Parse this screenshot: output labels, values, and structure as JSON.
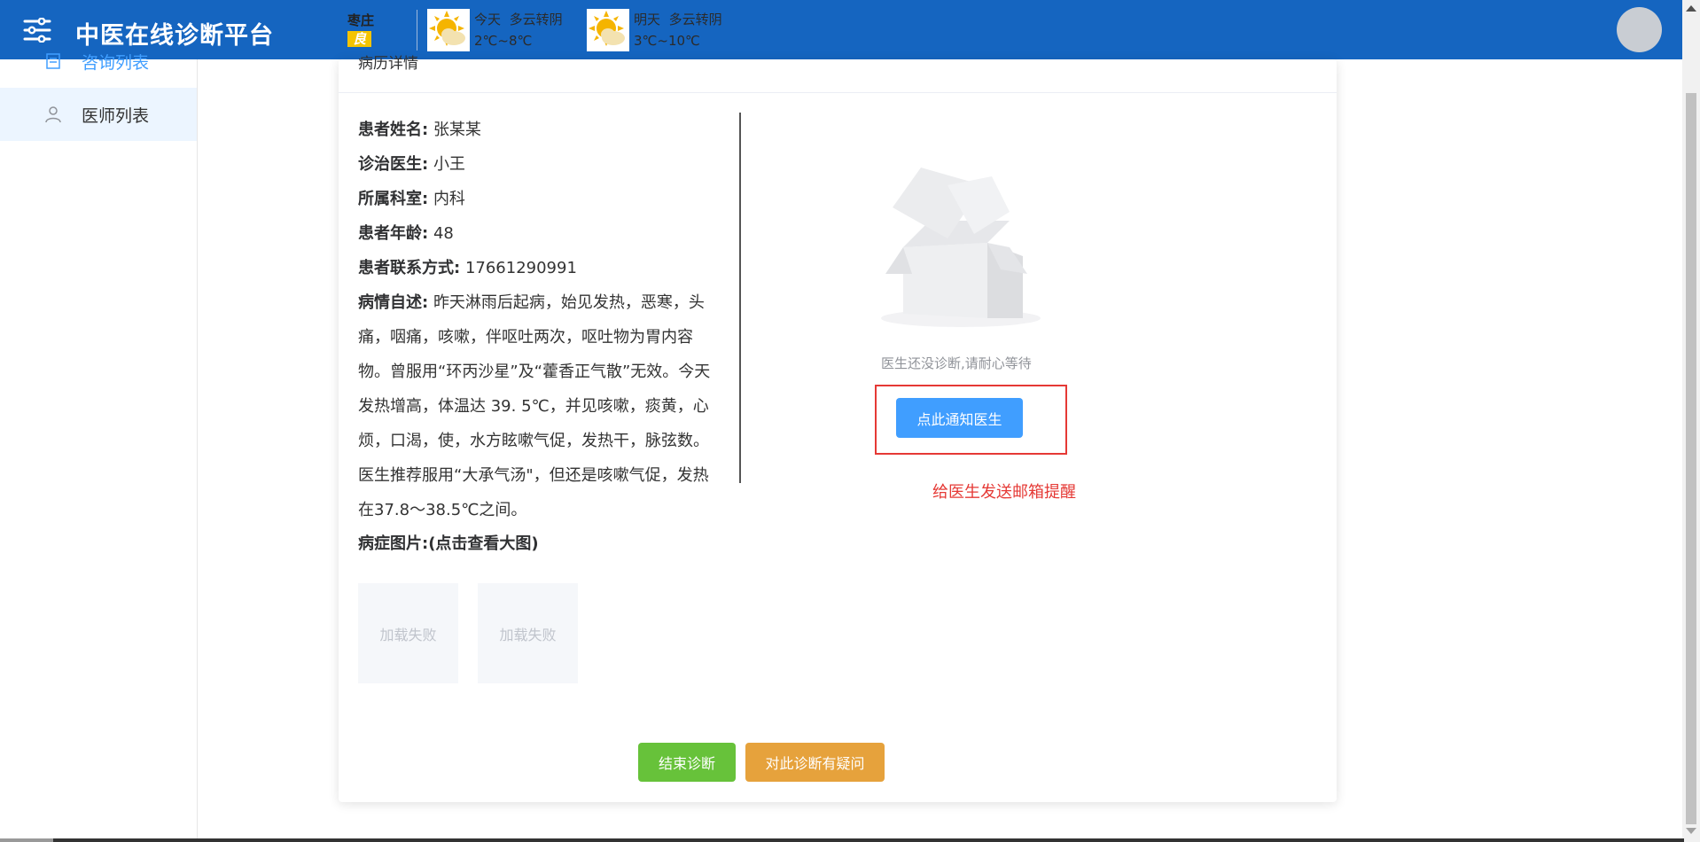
{
  "header": {
    "title": "中医在线诊断平台",
    "city": "枣庄",
    "air_quality": "良",
    "today_label": "今天",
    "today_weather": "多云转阴",
    "today_temp": "2℃~8℃",
    "tomorrow_label": "明天",
    "tomorrow_weather": "多云转阴",
    "tomorrow_temp": "3℃~10℃"
  },
  "sidebar": {
    "items": [
      {
        "label": "咨询列表",
        "icon": "document-icon",
        "active": false
      },
      {
        "label": "医师列表",
        "icon": "user-icon",
        "active": true
      }
    ]
  },
  "card": {
    "header_title": "病历详情",
    "fields": [
      {
        "label": "患者姓名:",
        "value": "张某某"
      },
      {
        "label": "诊治医生:",
        "value": "小王"
      },
      {
        "label": "所属科室:",
        "value": "内科"
      },
      {
        "label": "患者年龄:",
        "value": "48"
      },
      {
        "label": "患者联系方式:",
        "value": "17661290991"
      }
    ],
    "description_label": "病情自述:",
    "description": "昨天淋雨后起病，始见发热，恶寒，头痛，咽痛，咳嗽，伴呕吐两次，呕吐物为胃内容物。曾服用“环丙沙星”及“藿香正气散”无效。今天发热增高，体温达 39. 5℃，并见咳嗽，痰黄，心烦，口渴，使，水方眩嗽气促，发热干，脉弦数。医生推荐服用“大承气汤\"，但还是咳嗽气促，发热在37.8～38.5℃之间。",
    "pics_label": "病症图片:(点击查看大图)",
    "pics": [
      "加载失败",
      "加载失败"
    ],
    "empty_text": "医生还没诊断,请耐心等待",
    "notify_button": "点此通知医生",
    "note_text": "给医生发送邮箱提醒",
    "end_button": "结束诊断",
    "question_button": "对此诊断有疑问"
  },
  "colors": {
    "header_bg": "#1565c0",
    "primary": "#409eff",
    "success": "#67c23a",
    "warning": "#e6a23c",
    "danger": "#e53935"
  }
}
